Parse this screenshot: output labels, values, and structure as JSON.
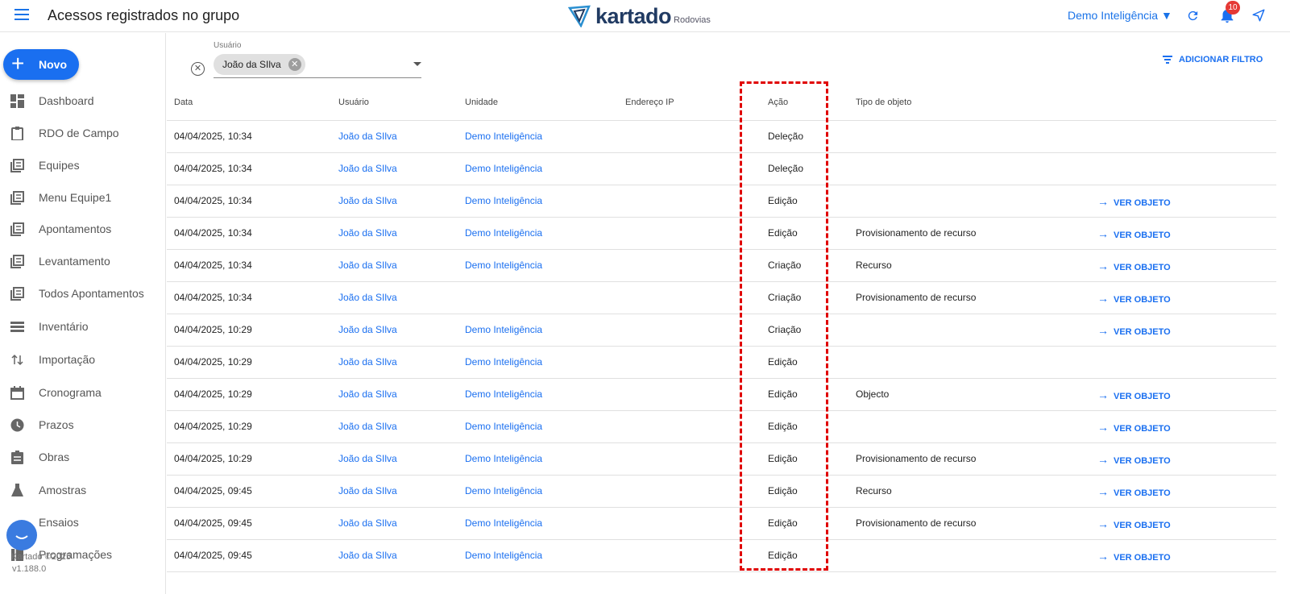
{
  "header": {
    "title": "Acessos registrados no grupo",
    "logo_text": "kartado",
    "logo_sub": "Rodovias",
    "group_select": "Demo Inteligência ▼",
    "notifications_count": "10"
  },
  "sidebar": {
    "new_button": "Novo",
    "items": [
      {
        "label": "Dashboard",
        "icon": "dashboard-icon"
      },
      {
        "label": "RDO de Campo",
        "icon": "clipboard-icon"
      },
      {
        "label": "Equipes",
        "icon": "list-icon"
      },
      {
        "label": "Menu Equipe1",
        "icon": "list-icon"
      },
      {
        "label": "Apontamentos",
        "icon": "list-icon"
      },
      {
        "label": "Levantamento",
        "icon": "list-icon"
      },
      {
        "label": "Todos Apontamentos",
        "icon": "list-icon"
      },
      {
        "label": "Inventário",
        "icon": "storage-icon"
      },
      {
        "label": "Importação",
        "icon": "import-icon"
      },
      {
        "label": "Cronograma",
        "icon": "calendar-icon"
      },
      {
        "label": "Prazos",
        "icon": "clock-icon"
      },
      {
        "label": "Obras",
        "icon": "assignment-icon"
      },
      {
        "label": "Amostras",
        "icon": "flask-icon"
      },
      {
        "label": "Ensaios",
        "icon": "chat-icon"
      },
      {
        "label": "Programações",
        "icon": "book-icon"
      }
    ],
    "footer_brand": "Kartado ©2025",
    "footer_version": "v1.188.0"
  },
  "filter": {
    "label": "Usuário",
    "chip": "João da SIlva",
    "add_filter": "ADICIONAR FILTRO"
  },
  "table": {
    "columns": [
      "Data",
      "Usuário",
      "Unidade",
      "Endereço IP",
      "Ação",
      "Tipo de objeto"
    ],
    "view_label": "VER OBJETO",
    "rows": [
      {
        "data": "04/04/2025, 10:34",
        "usuario": "João da SIlva",
        "unidade": "Demo Inteligência",
        "ip": "",
        "acao": "Deleção",
        "tipo": "",
        "ver": false
      },
      {
        "data": "04/04/2025, 10:34",
        "usuario": "João da SIlva",
        "unidade": "Demo Inteligência",
        "ip": "",
        "acao": "Deleção",
        "tipo": "",
        "ver": false
      },
      {
        "data": "04/04/2025, 10:34",
        "usuario": "João da SIlva",
        "unidade": "Demo Inteligência",
        "ip": "",
        "acao": "Edição",
        "tipo": "",
        "ver": true
      },
      {
        "data": "04/04/2025, 10:34",
        "usuario": "João da SIlva",
        "unidade": "Demo Inteligência",
        "ip": "",
        "acao": "Edição",
        "tipo": "Provisionamento de recurso",
        "ver": true
      },
      {
        "data": "04/04/2025, 10:34",
        "usuario": "João da SIlva",
        "unidade": "Demo Inteligência",
        "ip": "",
        "acao": "Criação",
        "tipo": "Recurso",
        "ver": true
      },
      {
        "data": "04/04/2025, 10:34",
        "usuario": "João da SIlva",
        "unidade": "",
        "ip": "",
        "acao": "Criação",
        "tipo": "Provisionamento de recurso",
        "ver": true
      },
      {
        "data": "04/04/2025, 10:29",
        "usuario": "João da SIlva",
        "unidade": "Demo Inteligência",
        "ip": "",
        "acao": "Criação",
        "tipo": "",
        "ver": true
      },
      {
        "data": "04/04/2025, 10:29",
        "usuario": "João da SIlva",
        "unidade": "Demo Inteligência",
        "ip": "",
        "acao": "Edição",
        "tipo": "",
        "ver": false
      },
      {
        "data": "04/04/2025, 10:29",
        "usuario": "João da SIlva",
        "unidade": "Demo Inteligência",
        "ip": "",
        "acao": "Edição",
        "tipo": "Objecto",
        "ver": true
      },
      {
        "data": "04/04/2025, 10:29",
        "usuario": "João da SIlva",
        "unidade": "Demo Inteligência",
        "ip": "",
        "acao": "Edição",
        "tipo": "",
        "ver": true
      },
      {
        "data": "04/04/2025, 10:29",
        "usuario": "João da SIlva",
        "unidade": "Demo Inteligência",
        "ip": "",
        "acao": "Edição",
        "tipo": "Provisionamento de recurso",
        "ver": true
      },
      {
        "data": "04/04/2025, 09:45",
        "usuario": "João da SIlva",
        "unidade": "Demo Inteligência",
        "ip": "",
        "acao": "Edição",
        "tipo": "Recurso",
        "ver": true
      },
      {
        "data": "04/04/2025, 09:45",
        "usuario": "João da SIlva",
        "unidade": "Demo Inteligência",
        "ip": "",
        "acao": "Edição",
        "tipo": "Provisionamento de recurso",
        "ver": true
      },
      {
        "data": "04/04/2025, 09:45",
        "usuario": "João da SIlva",
        "unidade": "Demo Inteligência",
        "ip": "",
        "acao": "Edição",
        "tipo": "",
        "ver": true
      }
    ]
  },
  "colors": {
    "accent": "#1a6ff0",
    "highlight": "#e00000",
    "badge": "#e53935"
  }
}
